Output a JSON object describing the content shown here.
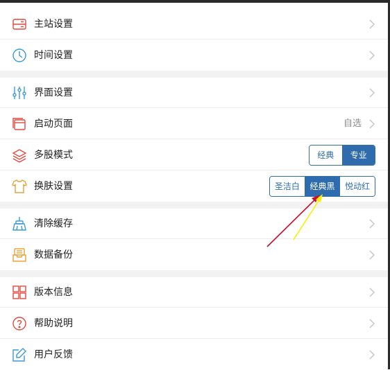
{
  "groups": [
    {
      "items": [
        {
          "label": "主站设置",
          "icon": "server-icon"
        },
        {
          "label": "时间设置",
          "icon": "clock-icon"
        }
      ]
    },
    {
      "items": [
        {
          "label": "界面设置",
          "icon": "sliders-icon"
        },
        {
          "label": "启动页面",
          "icon": "window-icon",
          "value": "自选"
        },
        {
          "label": "多股模式",
          "icon": "layers-icon",
          "segments": [
            "经典",
            "专业"
          ],
          "selected": "专业"
        },
        {
          "label": "换肤设置",
          "icon": "shirt-icon",
          "segments": [
            "圣洁白",
            "经典黑",
            "悦动红"
          ],
          "selected": "经典黑"
        }
      ]
    },
    {
      "items": [
        {
          "label": "清除缓存",
          "icon": "broom-icon"
        },
        {
          "label": "数据备份",
          "icon": "archive-icon"
        }
      ]
    },
    {
      "items": [
        {
          "label": "版本信息",
          "icon": "grid-icon"
        },
        {
          "label": "帮助说明",
          "icon": "help-icon"
        },
        {
          "label": "用户反馈",
          "icon": "edit-icon"
        }
      ]
    }
  ],
  "colors": {
    "accent": "#2f6cad",
    "icon_red": "#e0493f",
    "icon_blue": "#3a9bd6",
    "icon_orange": "#e8a33a",
    "annotation_red": "#c8102e",
    "annotation_yellow": "#f5f000"
  }
}
